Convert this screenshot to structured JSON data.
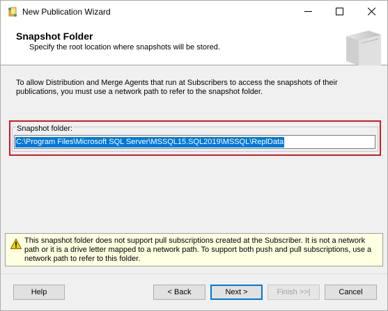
{
  "window": {
    "title": "New Publication Wizard",
    "icon": "wizard-app-icon"
  },
  "caption_buttons": {
    "minimize_icon": "minimize-icon",
    "maximize_icon": "maximize-icon",
    "close_icon": "close-icon"
  },
  "header": {
    "title": "Snapshot Folder",
    "subtitle": "Specify the root location where snapshots will be stored."
  },
  "description": "To allow Distribution and Merge Agents that run at Subscribers to access the snapshots of their publications, you must use a network path to refer to the snapshot folder.",
  "snapshot_folder": {
    "label": "Snapshot folder:",
    "value": "C:\\Program Files\\Microsoft SQL Server\\MSSQL15.SQL2019\\MSSQL\\ReplData",
    "highlight_color": "#c0202a"
  },
  "warning": {
    "icon": "warning-icon",
    "text": "This snapshot folder does not support pull subscriptions created at the Subscriber. It is not a network path or it is a drive letter mapped to a network path. To support both push and pull subscriptions, use a network path to refer to this folder."
  },
  "buttons": {
    "help": "Help",
    "back": "< Back",
    "next": "Next >",
    "finish": "Finish >>|",
    "cancel": "Cancel"
  },
  "colors": {
    "selection": "#0078d7",
    "warning_bg": "#ffffe1"
  }
}
